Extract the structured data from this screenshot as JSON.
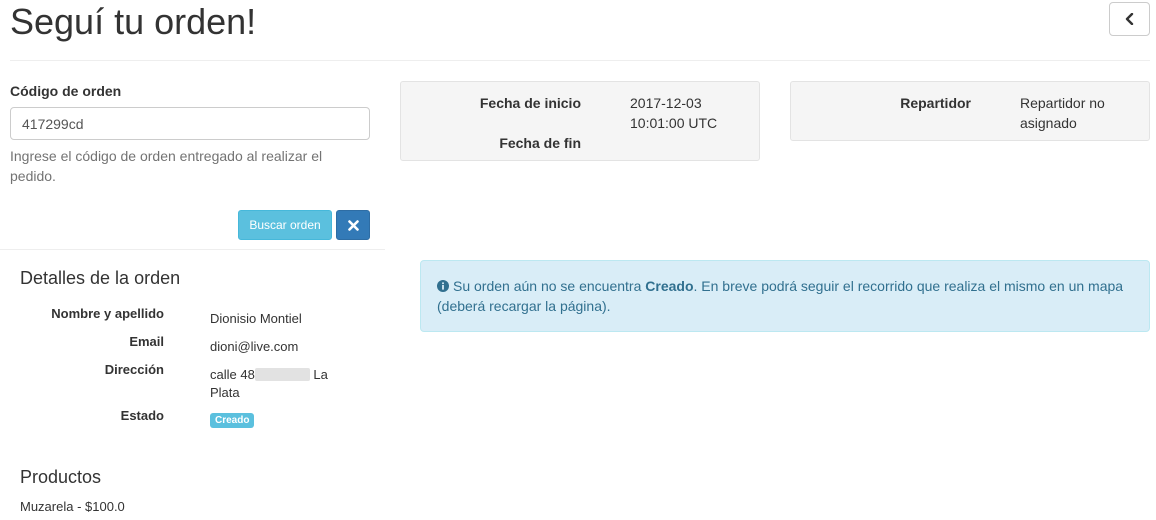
{
  "header": {
    "title": "Seguí tu orden!",
    "back_icon": "chevron-left-icon"
  },
  "search": {
    "label": "Código de orden",
    "value": "417299cd",
    "help": "Ingrese el código de orden entregado al realizar el pedido.",
    "search_button": "Buscar orden",
    "clear_icon": "close-icon"
  },
  "dates": {
    "start_label": "Fecha de inicio",
    "start_value_line1": "2017-12-03",
    "start_value_line2": "10:01:00 UTC",
    "end_label": "Fecha de fin",
    "end_value": ""
  },
  "driver": {
    "label": "Repartidor",
    "value_line1": "Repartidor no",
    "value_line2": "asignado"
  },
  "details": {
    "title": "Detalles de la orden",
    "name_label": "Nombre y apellido",
    "name_value": "Dionisio Montiel",
    "email_label": "Email",
    "email_value": "dioni@live.com",
    "address_label": "Dirección",
    "address_value_start": "calle 48",
    "address_value_end": " La",
    "address_value_line2": "Plata",
    "status_label": "Estado",
    "status_value": "Creado"
  },
  "products": {
    "title": "Productos",
    "items": [
      "Muzarela - $100.0"
    ]
  },
  "alert": {
    "text_before": "Su orden aún no se encuentra ",
    "status": "Creado",
    "text_after": ". En breve podrá seguir el recorrido que realiza el mismo en un mapa (deberá recargar la página).",
    "icon": "info-circle-icon"
  },
  "colors": {
    "info": "#5bc0de",
    "primary": "#337ab7",
    "alert_bg": "#d9edf7",
    "alert_text": "#31708f"
  }
}
